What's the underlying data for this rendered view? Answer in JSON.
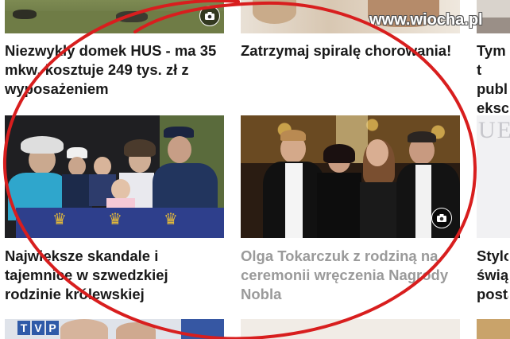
{
  "watermark": "www.wiocha.pl",
  "articles": [
    {
      "title": "Niezwykły domek HUS - ma 35 mkw, kosztuje 249 tys. zł z wyposażeniem",
      "has_gallery": true
    },
    {
      "title": "Zatrzymaj spiralę chorowania!",
      "has_gallery": false
    },
    {
      "title": "Tym t publ eksc",
      "has_gallery": false
    },
    {
      "title": "Największe skandale i tajemnice w szwedzkiej rodzinie królewskiej",
      "has_gallery": false
    },
    {
      "title": "Olga Tokarczuk z rodziną na ceremonii wręczenia Nagrody Nobla",
      "has_gallery": true,
      "visited": true
    },
    {
      "title": "Stylo świąt posta",
      "has_gallery": false
    }
  ],
  "partial_image_text": "UE",
  "bottom_logo": "TVP",
  "colors": {
    "circle": "#d81e1e",
    "text": "#1a1a1a",
    "visited_text": "#9a9a9a"
  }
}
